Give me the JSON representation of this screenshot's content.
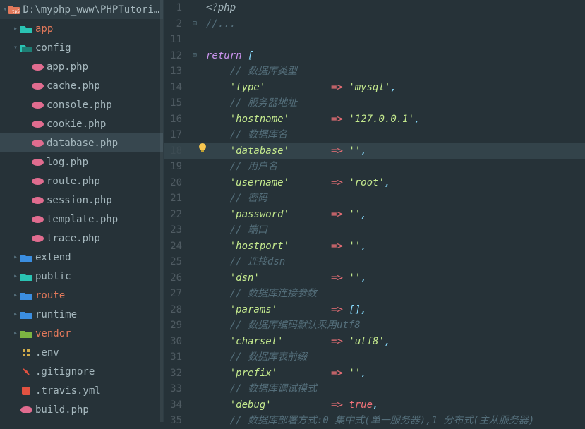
{
  "path_title": "D:\\myphp_www\\PHPTutorial\\W…",
  "tree": {
    "app": "app",
    "config": "config",
    "app_php": "app.php",
    "cache_php": "cache.php",
    "console_php": "console.php",
    "cookie_php": "cookie.php",
    "database_php": "database.php",
    "log_php": "log.php",
    "route_php": "route.php",
    "session_php": "session.php",
    "template_php": "template.php",
    "trace_php": "trace.php",
    "extend": "extend",
    "public": "public",
    "route": "route",
    "runtime": "runtime",
    "vendor": "vendor",
    "env": ".env",
    "gitignore": ".gitignore",
    "travis": ".travis.yml",
    "build_php": "build.php"
  },
  "gutter_start": 1,
  "code": {
    "l1": "<?php",
    "l2": "//...",
    "l11": "",
    "l12_kw": "return",
    "l13_cmt": "// 数据库类型",
    "l14_k": "'type'",
    "l14_v": "'mysql'",
    "l15_cmt": "// 服务器地址",
    "l16_k": "'hostname'",
    "l16_v": "'127.0.0.1'",
    "l17_cmt": "// 数据库名",
    "l18_k": "'database'",
    "l18_v": "''",
    "l19_cmt": "// 用户名",
    "l20_k": "'username'",
    "l20_v": "'root'",
    "l21_cmt": "// 密码",
    "l22_k": "'password'",
    "l22_v": "''",
    "l23_cmt": "// 端口",
    "l24_k": "'hostport'",
    "l24_v": "''",
    "l25_cmt": "// 连接dsn",
    "l26_k": "'dsn'",
    "l26_v": "''",
    "l27_cmt": "// 数据库连接参数",
    "l28_k": "'params'",
    "l28_v": "[]",
    "l29_cmt": "// 数据库编码默认采用utf8",
    "l30_k": "'charset'",
    "l30_v": "'utf8'",
    "l31_cmt": "// 数据库表前缀",
    "l32_k": "'prefix'",
    "l32_v": "''",
    "l33_cmt": "// 数据库调试模式",
    "l34_k": "'debug'",
    "l34_v": "true",
    "l35_cmt": "// 数据库部署方式:0 集中式(单一服务器),1 分布式(主从服务器)"
  },
  "line_numbers": [
    "1",
    "2",
    "11",
    "12",
    "13",
    "14",
    "15",
    "16",
    "17",
    "18",
    "19",
    "20",
    "21",
    "22",
    "23",
    "24",
    "25",
    "26",
    "27",
    "28",
    "29",
    "30",
    "31",
    "32",
    "33",
    "34",
    "35"
  ]
}
